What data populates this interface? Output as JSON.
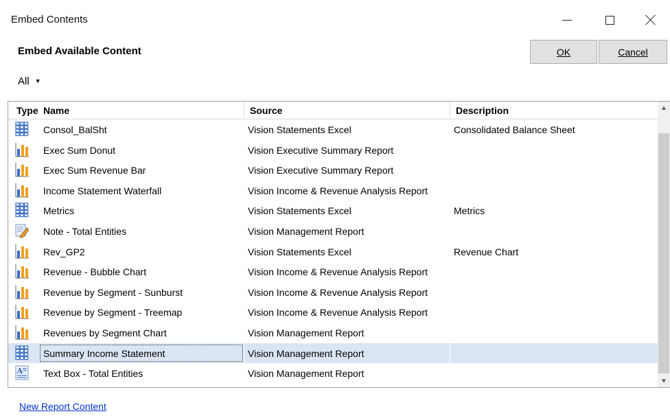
{
  "window": {
    "title": "Embed Contents"
  },
  "heading": "Embed Available Content",
  "buttons": {
    "ok": "OK",
    "cancel": "Cancel"
  },
  "filter": {
    "value": "All"
  },
  "columns": {
    "type": "Type",
    "name": "Name",
    "source": "Source",
    "description": "Description"
  },
  "rows": [
    {
      "icon": "grid-icon",
      "name": "Consol_BalSht",
      "source": "Vision Statements Excel",
      "description": "Consolidated Balance Sheet"
    },
    {
      "icon": "bar-chart-icon",
      "name": "Exec Sum Donut",
      "source": "Vision Executive Summary Report",
      "description": ""
    },
    {
      "icon": "bar-chart-icon",
      "name": "Exec Sum Revenue Bar",
      "source": "Vision Executive Summary Report",
      "description": ""
    },
    {
      "icon": "bar-chart-icon",
      "name": "Income Statement Waterfall",
      "source": "Vision Income & Revenue Analysis Report",
      "description": ""
    },
    {
      "icon": "grid-icon",
      "name": "Metrics",
      "source": "Vision Statements Excel",
      "description": "Metrics"
    },
    {
      "icon": "note-icon",
      "name": "Note - Total Entities",
      "source": "Vision Management Report",
      "description": ""
    },
    {
      "icon": "bar-chart-icon",
      "name": "Rev_GP2",
      "source": "Vision Statements Excel",
      "description": "Revenue Chart"
    },
    {
      "icon": "bar-chart-icon",
      "name": "Revenue - Bubble Chart",
      "source": "Vision Income & Revenue Analysis Report",
      "description": ""
    },
    {
      "icon": "bar-chart-icon",
      "name": "Revenue by Segment - Sunburst",
      "source": "Vision Income & Revenue Analysis Report",
      "description": ""
    },
    {
      "icon": "bar-chart-icon",
      "name": "Revenue by Segment - Treemap",
      "source": "Vision Income & Revenue Analysis Report",
      "description": ""
    },
    {
      "icon": "bar-chart-icon",
      "name": "Revenues by Segment Chart",
      "source": "Vision Management Report",
      "description": ""
    },
    {
      "icon": "grid-icon",
      "name": "Summary Income Statement",
      "source": "Vision Management Report",
      "description": "",
      "selected": true
    },
    {
      "icon": "text-box-icon",
      "name": "Text Box - Total Entities",
      "source": "Vision Management Report",
      "description": ""
    }
  ],
  "footer": {
    "link": "New Report Content"
  },
  "colors": {
    "selection": "#d9e5f3",
    "link": "#0033cc",
    "grid_icon": "#3a6fc4",
    "bar_orange": "#f0a020",
    "bar_blue": "#3a6fc4"
  }
}
